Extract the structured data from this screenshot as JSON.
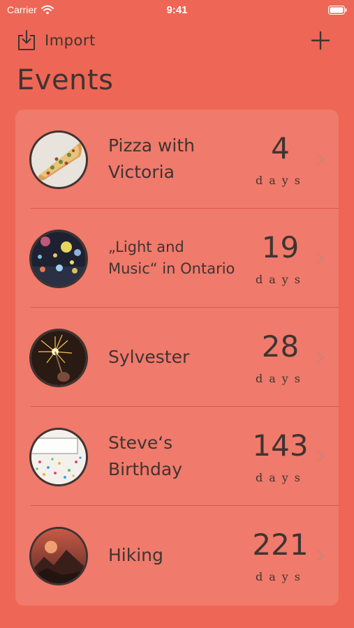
{
  "status_bar": {
    "carrier": "Carrier",
    "time": "9:41"
  },
  "nav": {
    "import_label": "Import"
  },
  "page": {
    "title": "Events"
  },
  "events": [
    {
      "title": "Pizza with\nVictoria",
      "count": "4",
      "unit": "days",
      "image": "pizza"
    },
    {
      "title": "„Light and\nMusic“ in Ontario",
      "count": "19",
      "unit": "days",
      "image": "concert-lights"
    },
    {
      "title": "Sylvester",
      "count": "28",
      "unit": "days",
      "image": "sparkler"
    },
    {
      "title": "Steve‘s\nBirthday",
      "count": "143",
      "unit": "days",
      "image": "birthday-sign"
    },
    {
      "title": "Hiking",
      "count": "221",
      "unit": "days",
      "image": "mountain-sunset"
    }
  ],
  "colors": {
    "background": "#ee6655",
    "card": "#f07a6b",
    "text": "#3f3432",
    "separator": "#d9594b"
  }
}
